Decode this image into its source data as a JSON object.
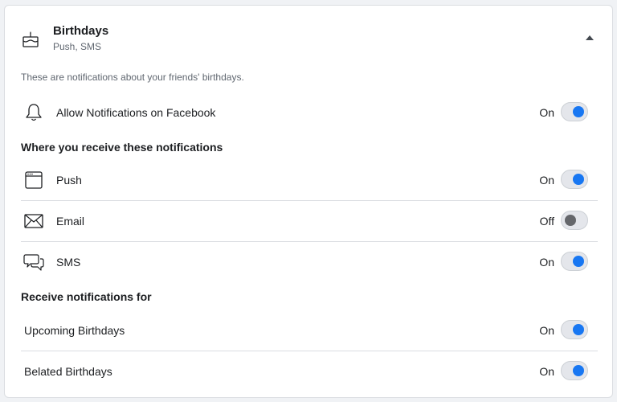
{
  "header": {
    "title": "Birthdays",
    "subtitle": "Push, SMS",
    "icon": "cake-icon"
  },
  "description": "These are notifications about your friends' birthdays.",
  "allow": {
    "label": "Allow Notifications on Facebook",
    "state": "On",
    "icon": "bell-icon"
  },
  "where": {
    "title": "Where you receive these notifications",
    "items": [
      {
        "label": "Push",
        "state": "On",
        "icon": "browser-window-icon"
      },
      {
        "label": "Email",
        "state": "Off",
        "icon": "envelope-icon"
      },
      {
        "label": "SMS",
        "state": "On",
        "icon": "chat-bubbles-icon"
      }
    ]
  },
  "receive": {
    "title": "Receive notifications for",
    "items": [
      {
        "label": "Upcoming Birthdays",
        "state": "On"
      },
      {
        "label": "Belated Birthdays",
        "state": "On"
      }
    ]
  },
  "colors": {
    "toggle_on": "#1877f2",
    "toggle_off": "#65676b",
    "track": "#e4e6eb"
  }
}
